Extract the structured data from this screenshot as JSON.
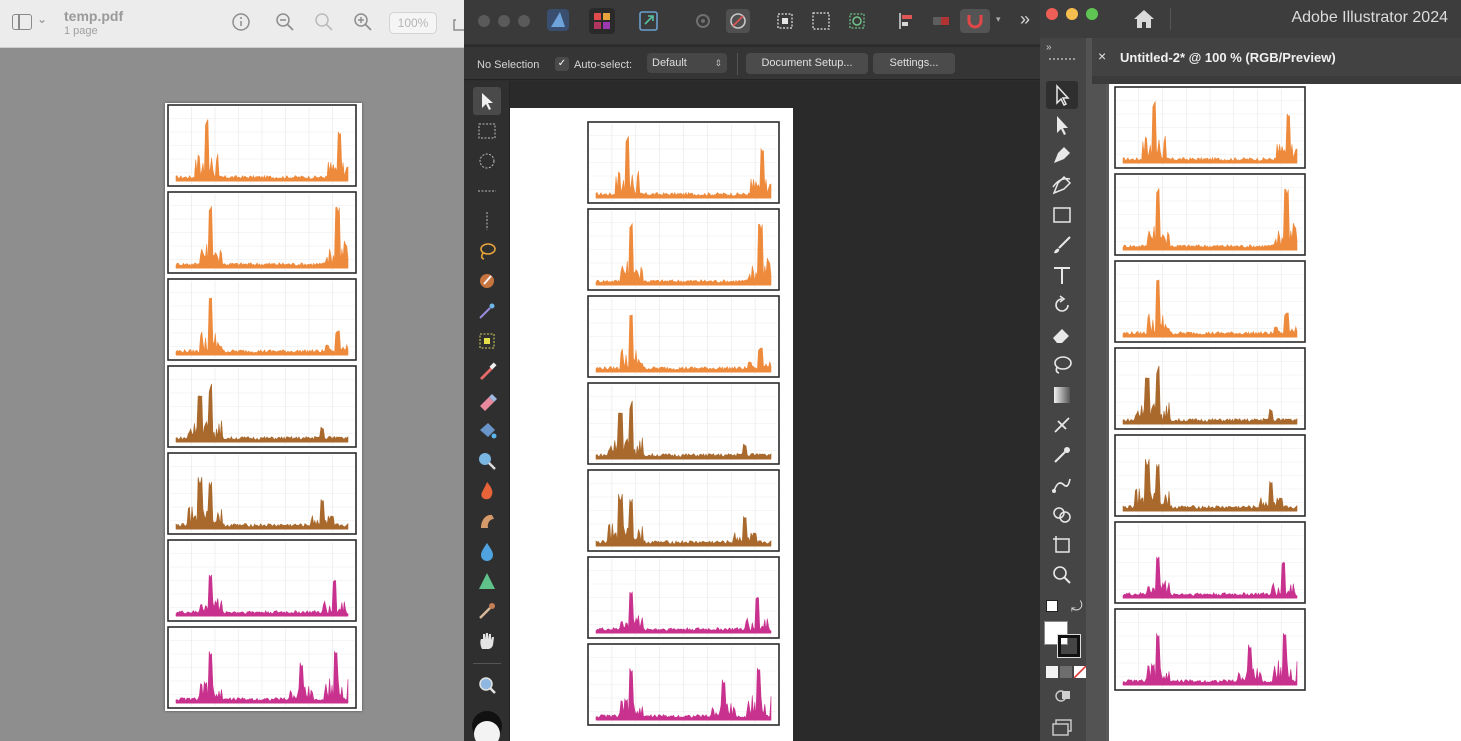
{
  "preview": {
    "doc_title": "temp.pdf",
    "doc_pages": "1 page",
    "zoom_label": "100%",
    "icons": [
      "sidebar-icon",
      "chevron-down-icon",
      "info-icon",
      "zoom-out-icon",
      "zoom-fit-icon",
      "zoom-in-icon",
      "share-icon"
    ]
  },
  "affinity": {
    "context": {
      "selection_label": "No Selection",
      "autoselect_label": "Auto-select:",
      "autoselect_value": "Default",
      "document_setup_label": "Document Setup...",
      "settings_label": "Settings..."
    },
    "more_label": "»",
    "tools": [
      "move-tool-icon",
      "rect-marquee-icon",
      "ellipse-marquee-icon",
      "row-marquee-icon",
      "column-marquee-icon",
      "freehand-selection-icon",
      "selection-brush-icon",
      "magic-wand-icon",
      "pixel-select-icon",
      "paint-brush-icon",
      "erase-brush-icon",
      "flood-fill-icon",
      "blur-icon",
      "burn-icon",
      "smudge-icon",
      "sharpen-icon",
      "vector-tool-icon",
      "color-picker-icon",
      "hand-icon",
      "zoom-icon"
    ]
  },
  "illustrator": {
    "app_title": "Adobe Illustrator 2024",
    "doc_tab": "Untitled-2* @ 100 % (RGB/Preview)",
    "close_label": "×",
    "panel_toggle": "»",
    "tools": [
      "selection-tool-icon",
      "direct-selection-tool-icon",
      "pen-tool-icon",
      "curvature-tool-icon",
      "rectangle-tool-icon",
      "paintbrush-tool-icon",
      "type-tool-icon",
      "rotate-tool-icon",
      "eraser-tool-icon",
      "lasso-tool-icon",
      "gradient-tool-icon",
      "eyedropper-tool-icon",
      "blend-tool-icon",
      "puppet-warp-tool-icon",
      "shape-builder-tool-icon",
      "artboard-tool-icon",
      "zoom-tool-icon"
    ]
  },
  "chart_data": [
    {
      "type": "area",
      "color": "#ee8a3c",
      "peaks": [
        [
          0.18,
          0.95
        ],
        [
          0.95,
          0.72
        ]
      ]
    },
    {
      "type": "area",
      "color": "#ee8a3c",
      "peaks": [
        [
          0.2,
          0.95
        ],
        [
          0.94,
          0.9
        ]
      ]
    },
    {
      "type": "area",
      "color": "#ee8a3c",
      "peaks": [
        [
          0.2,
          0.85
        ],
        [
          0.94,
          0.35
        ]
      ]
    },
    {
      "type": "area",
      "color": "#a9692c",
      "peaks": [
        [
          0.14,
          0.7
        ],
        [
          0.2,
          0.85
        ],
        [
          0.85,
          0.22
        ]
      ]
    },
    {
      "type": "area",
      "color": "#a9692c",
      "peaks": [
        [
          0.14,
          0.78
        ],
        [
          0.2,
          0.7
        ],
        [
          0.85,
          0.45
        ]
      ]
    },
    {
      "type": "area",
      "color": "#c8328e",
      "peaks": [
        [
          0.2,
          0.65
        ],
        [
          0.92,
          0.55
        ]
      ]
    },
    {
      "type": "area",
      "color": "#c8328e",
      "peaks": [
        [
          0.2,
          0.75
        ],
        [
          0.73,
          0.6
        ],
        [
          0.93,
          0.8
        ]
      ]
    }
  ]
}
